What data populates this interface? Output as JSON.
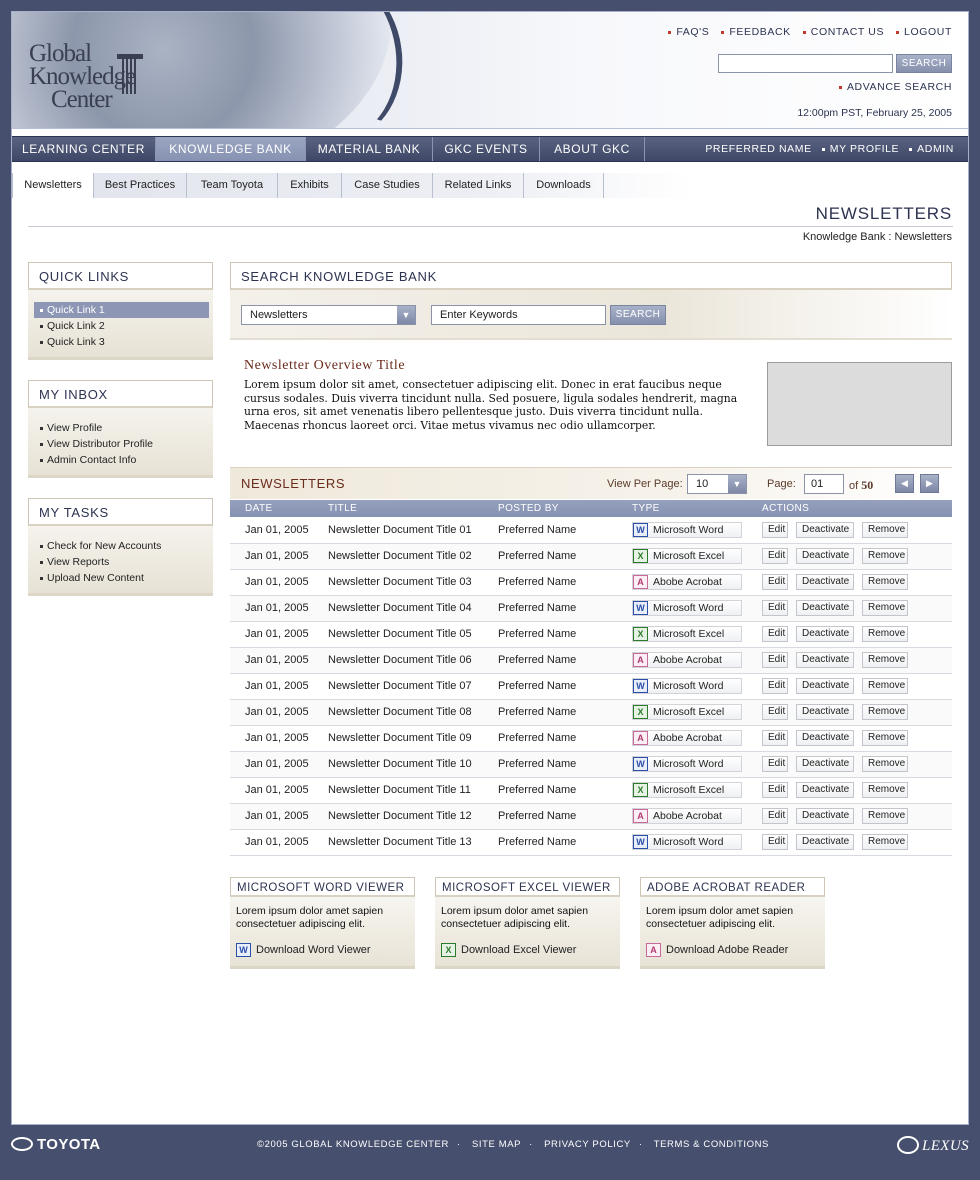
{
  "header": {
    "logo_lines": [
      "Global",
      "Knowledge",
      "Center"
    ],
    "top_links": [
      "FAQ'S",
      "FEEDBACK",
      "CONTACT US",
      "LOGOUT"
    ],
    "search_value": "",
    "search_button": "SEARCH",
    "advance_search": "ADVANCE SEARCH",
    "datetime": "12:00pm PST, February 25, 2005"
  },
  "mainnav": {
    "items": [
      "LEARNING CENTER",
      "KNOWLEDGE BANK",
      "MATERIAL BANK",
      "GKC EVENTS",
      "ABOUT GKC"
    ],
    "active": "KNOWLEDGE BANK",
    "right": [
      "PREFERRED NAME",
      "MY PROFILE",
      "ADMIN"
    ]
  },
  "subnav": {
    "tabs": [
      "Newsletters",
      "Best Practices",
      "Team Toyota",
      "Exhibits",
      "Case Studies",
      "Related Links",
      "Downloads"
    ],
    "active": "Newsletters"
  },
  "page": {
    "title": "NEWSLETTERS",
    "breadcrumb": "Knowledge Bank : Newsletters"
  },
  "sidebar": {
    "quick_links": {
      "title": "QUICK LINKS",
      "items": [
        "Quick Link 1",
        "Quick Link 2",
        "Quick Link 3"
      ],
      "selected": "Quick Link 1"
    },
    "inbox": {
      "title": "MY INBOX",
      "items": [
        "View Profile",
        "View Distributor Profile",
        "Admin Contact Info"
      ]
    },
    "tasks": {
      "title": "MY TASKS",
      "items": [
        "Check for New Accounts",
        "View Reports",
        "Upload New Content"
      ]
    }
  },
  "search_kb": {
    "title": "SEARCH KNOWLEDGE BANK",
    "category": "Newsletters",
    "keywords_placeholder": "Enter Keywords",
    "button": "SEARCH"
  },
  "overview": {
    "title": "Newsletter Overview Title",
    "body": "Lorem ipsum dolor sit amet, consectetuer adipiscing elit. Donec in erat faucibus neque cursus sodales. Duis viverra tincidunt nulla. Sed posuere, ligula sodales hendrerit, magna urna eros, sit amet venenatis libero pellentesque justo. Duis viverra tincidunt nulla. Maecenas rhoncus laoreet orci. Vitae metus vivamus nec odio ullamcorper."
  },
  "newsletters": {
    "title": "NEWSLETTERS",
    "view_per_page_label": "View Per Page:",
    "view_per_page": "10",
    "page_label": "Page:",
    "page": "01",
    "of_label": "of",
    "total_pages": "50",
    "prev_glyph": "◀",
    "next_glyph": "▶",
    "columns": [
      "DATE",
      "TITLE",
      "POSTED BY",
      "TYPE",
      "ACTIONS"
    ],
    "actions": [
      "Edit",
      "Deactivate",
      "Remove"
    ],
    "rows": [
      {
        "date": "Jan 01, 2005",
        "title": "Newsletter Document Title 01",
        "posted_by": "Preferred Name",
        "type": "Microsoft Word",
        "icon": "word"
      },
      {
        "date": "Jan 01, 2005",
        "title": "Newsletter Document Title 02",
        "posted_by": "Preferred Name",
        "type": "Microsoft Excel",
        "icon": "excel"
      },
      {
        "date": "Jan 01, 2005",
        "title": "Newsletter Document Title 03",
        "posted_by": "Preferred Name",
        "type": "Abobe Acrobat",
        "icon": "pdf"
      },
      {
        "date": "Jan 01, 2005",
        "title": "Newsletter Document Title 04",
        "posted_by": "Preferred Name",
        "type": "Microsoft Word",
        "icon": "word"
      },
      {
        "date": "Jan 01, 2005",
        "title": "Newsletter Document Title 05",
        "posted_by": "Preferred Name",
        "type": "Microsoft Excel",
        "icon": "excel"
      },
      {
        "date": "Jan 01, 2005",
        "title": "Newsletter Document Title 06",
        "posted_by": "Preferred Name",
        "type": "Abobe Acrobat",
        "icon": "pdf"
      },
      {
        "date": "Jan 01, 2005",
        "title": "Newsletter Document Title 07",
        "posted_by": "Preferred Name",
        "type": "Microsoft Word",
        "icon": "word"
      },
      {
        "date": "Jan 01, 2005",
        "title": "Newsletter Document Title 08",
        "posted_by": "Preferred Name",
        "type": "Microsoft Excel",
        "icon": "excel"
      },
      {
        "date": "Jan 01, 2005",
        "title": "Newsletter Document Title 09",
        "posted_by": "Preferred Name",
        "type": "Abobe Acrobat",
        "icon": "pdf"
      },
      {
        "date": "Jan 01, 2005",
        "title": "Newsletter Document Title 10",
        "posted_by": "Preferred Name",
        "type": "Microsoft Word",
        "icon": "word"
      },
      {
        "date": "Jan 01, 2005",
        "title": "Newsletter Document Title 11",
        "posted_by": "Preferred Name",
        "type": "Microsoft Excel",
        "icon": "excel"
      },
      {
        "date": "Jan 01, 2005",
        "title": "Newsletter Document Title 12",
        "posted_by": "Preferred Name",
        "type": "Abobe Acrobat",
        "icon": "pdf"
      },
      {
        "date": "Jan 01, 2005",
        "title": "Newsletter Document Title 13",
        "posted_by": "Preferred Name",
        "type": "Microsoft Word",
        "icon": "word"
      }
    ]
  },
  "viewers": [
    {
      "title": "MICROSOFT WORD VIEWER",
      "body": "Lorem ipsum dolor amet sapien consectetuer adipiscing elit.",
      "link": "Download Word Viewer",
      "icon": "word"
    },
    {
      "title": "MICROSOFT EXCEL VIEWER",
      "body": "Lorem ipsum dolor amet sapien consectetuer adipiscing elit.",
      "link": "Download Excel Viewer",
      "icon": "excel"
    },
    {
      "title": "ADOBE ACROBAT READER",
      "body": "Lorem ipsum dolor amet sapien consectetuer adipiscing elit.",
      "link": "Download Adobe Reader",
      "icon": "pdf"
    }
  ],
  "footer": {
    "left_brand": "TOYOTA",
    "links": [
      "©2005 GLOBAL KNOWLEDGE CENTER",
      "SITE MAP",
      "PRIVACY POLICY",
      "TERMS & CONDITIONS"
    ],
    "separator": "·",
    "right_brand": "LEXUS"
  },
  "colors": {
    "background": "#46506e",
    "nav": "#4b5473",
    "nav_active": "#8d98b7",
    "accent_red": "#6b2b1d",
    "table_header": "#8e99b8"
  }
}
